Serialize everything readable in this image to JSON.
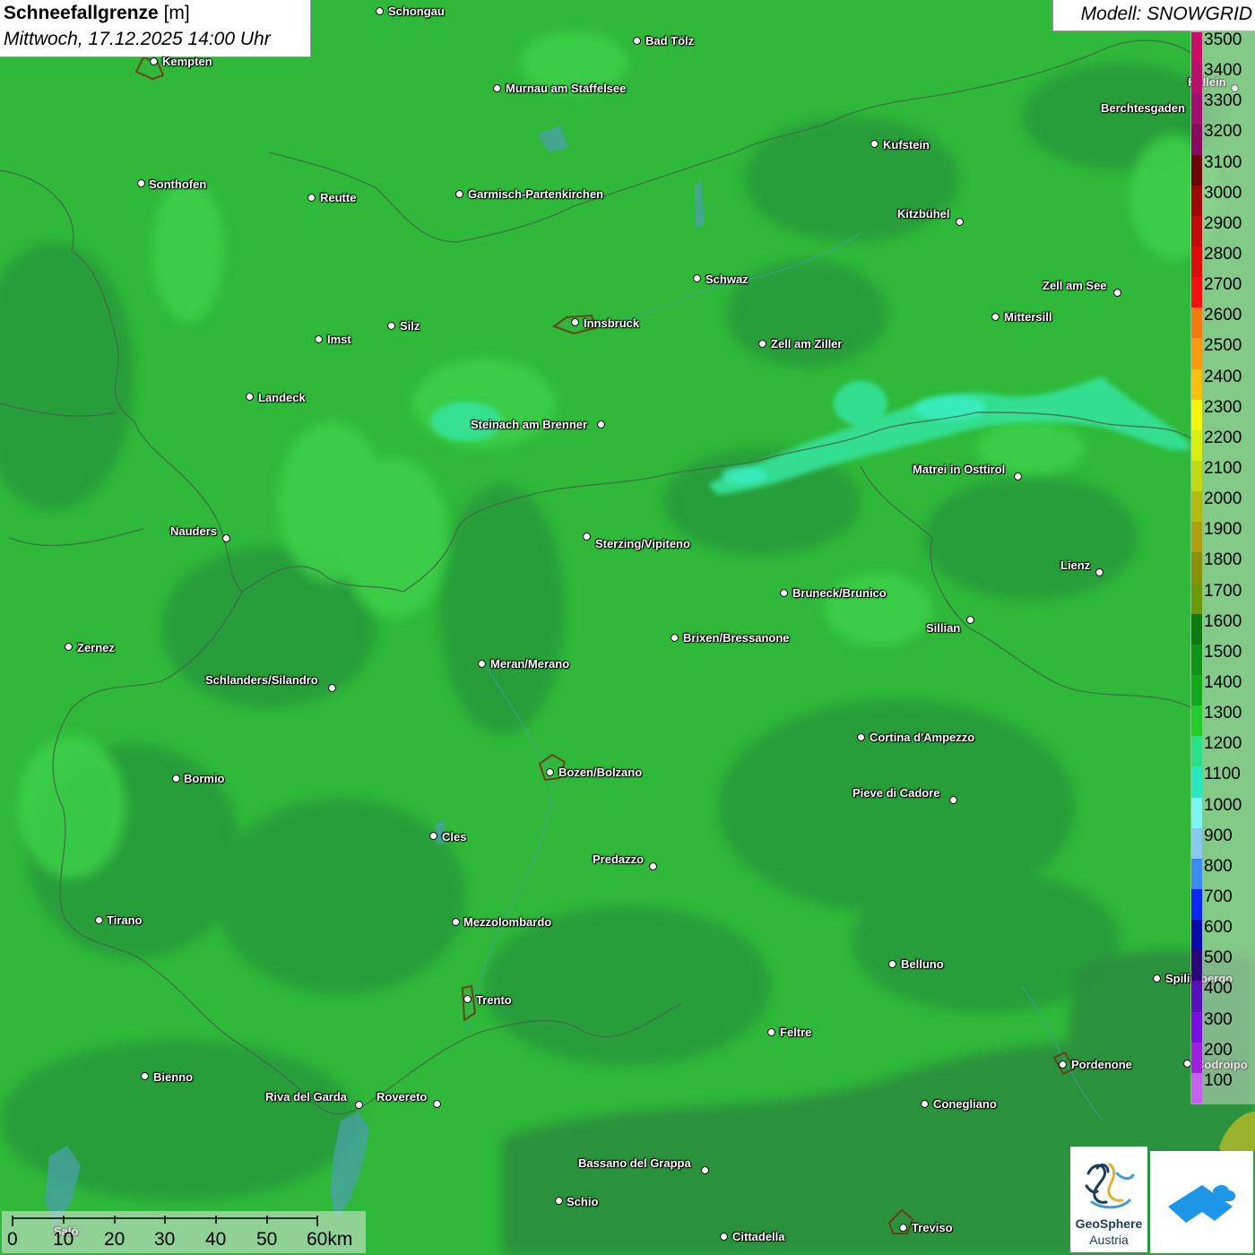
{
  "title": {
    "main": "Schneefallgrenze",
    "unit": "[m]",
    "datetime": "Mittwoch, 17.12.2025 14:00 Uhr"
  },
  "model_label": "Modell: SNOWGRID",
  "legend": {
    "levels": [
      {
        "label": "3500",
        "color": "#c8106a"
      },
      {
        "label": "3400",
        "color": "#b8106a"
      },
      {
        "label": "3300",
        "color": "#a00d6d"
      },
      {
        "label": "3200",
        "color": "#8a0a60"
      },
      {
        "label": "3100",
        "color": "#6e0808"
      },
      {
        "label": "3000",
        "color": "#a00808"
      },
      {
        "label": "2900",
        "color": "#c20a0a"
      },
      {
        "label": "2800",
        "color": "#dc0c0c"
      },
      {
        "label": "2700",
        "color": "#f21010"
      },
      {
        "label": "2600",
        "color": "#f47a10"
      },
      {
        "label": "2500",
        "color": "#f79a10"
      },
      {
        "label": "2400",
        "color": "#f7c010"
      },
      {
        "label": "2300",
        "color": "#f5f510"
      },
      {
        "label": "2200",
        "color": "#d8ee10"
      },
      {
        "label": "2100",
        "color": "#c2d810"
      },
      {
        "label": "2000",
        "color": "#b2bc10"
      },
      {
        "label": "1900",
        "color": "#b0a010"
      },
      {
        "label": "1800",
        "color": "#8a900a"
      },
      {
        "label": "1700",
        "color": "#6c9a0c"
      },
      {
        "label": "1600",
        "color": "#0e7a12"
      },
      {
        "label": "1500",
        "color": "#0e9416"
      },
      {
        "label": "1400",
        "color": "#12aa1c"
      },
      {
        "label": "1300",
        "color": "#22cc2a"
      },
      {
        "label": "1200",
        "color": "#2ce08a"
      },
      {
        "label": "1100",
        "color": "#2ae8c0"
      },
      {
        "label": "1000",
        "color": "#7af5f0"
      },
      {
        "label": "900",
        "color": "#88c8f0"
      },
      {
        "label": "800",
        "color": "#3a8cf0"
      },
      {
        "label": "700",
        "color": "#0c28f0"
      },
      {
        "label": "600",
        "color": "#0a0aa8"
      },
      {
        "label": "500",
        "color": "#2a0878"
      },
      {
        "label": "400",
        "color": "#5a10b8"
      },
      {
        "label": "300",
        "color": "#7a10e0"
      },
      {
        "label": "200",
        "color": "#a020e0"
      },
      {
        "label": "100",
        "color": "#c860ee"
      }
    ]
  },
  "places": [
    {
      "name": "Schongau",
      "dot": [
        424,
        13
      ],
      "label": [
        433,
        5
      ]
    },
    {
      "name": "Kempten",
      "dot": [
        172,
        69
      ],
      "label": [
        181,
        61
      ]
    },
    {
      "name": "Bad Tölz",
      "dot": [
        711,
        46
      ],
      "label": [
        720,
        38
      ]
    },
    {
      "name": "Murnau am Staffelsee",
      "dot": [
        555,
        99
      ],
      "label": [
        564,
        91
      ]
    },
    {
      "name": "Hallein",
      "dot": [
        1378,
        99
      ],
      "label": [
        1325,
        84
      ]
    },
    {
      "name": "Berchtesgaden",
      "dot": null,
      "label": [
        1228,
        113
      ]
    },
    {
      "name": "Kufstein",
      "dot": [
        976,
        161
      ],
      "label": [
        985,
        154
      ]
    },
    {
      "name": "Sonthofen",
      "dot": [
        158,
        205
      ],
      "label": [
        166,
        198
      ]
    },
    {
      "name": "Reutte",
      "dot": [
        348,
        221
      ],
      "label": [
        357,
        213
      ]
    },
    {
      "name": "Garmisch-Partenkirchen",
      "dot": [
        513,
        217
      ],
      "label": [
        522,
        209
      ]
    },
    {
      "name": "Kitzbühel",
      "dot": [
        1071,
        248
      ],
      "label": [
        1001,
        231
      ]
    },
    {
      "name": "Schwaz",
      "dot": [
        778,
        311
      ],
      "label": [
        787,
        304
      ]
    },
    {
      "name": "Zell am See",
      "dot": [
        1247,
        327
      ],
      "label": [
        1163,
        311
      ]
    },
    {
      "name": "Mittersill",
      "dot": [
        1111,
        354
      ],
      "label": [
        1120,
        346
      ]
    },
    {
      "name": "Innsbruck",
      "dot": [
        642,
        360
      ],
      "label": [
        651,
        353
      ]
    },
    {
      "name": "Silz",
      "dot": [
        437,
        364
      ],
      "label": [
        446,
        356
      ]
    },
    {
      "name": "Imst",
      "dot": [
        356,
        379
      ],
      "label": [
        365,
        371
      ]
    },
    {
      "name": "Zell am Ziller",
      "dot": [
        851,
        384
      ],
      "label": [
        860,
        376
      ]
    },
    {
      "name": "Landeck",
      "dot": [
        279,
        443
      ],
      "label": [
        288,
        436
      ]
    },
    {
      "name": "Steinach am Brenner",
      "dot": [
        671,
        474
      ],
      "label": [
        525,
        466
      ]
    },
    {
      "name": "Matrei in Osttirol",
      "dot": [
        1136,
        532
      ],
      "label": [
        1018,
        516
      ]
    },
    {
      "name": "Nauders",
      "dot": [
        253,
        601
      ],
      "label": [
        190,
        585
      ]
    },
    {
      "name": "Sterzing/Vipiteno",
      "dot": [
        655,
        599
      ],
      "label": [
        664,
        599
      ]
    },
    {
      "name": "Lienz",
      "dot": [
        1227,
        639
      ],
      "label": [
        1183,
        623
      ]
    },
    {
      "name": "Bruneck/Brunico",
      "dot": [
        875,
        662
      ],
      "label": [
        884,
        654
      ]
    },
    {
      "name": "Sillian",
      "dot": [
        1083,
        692
      ],
      "label": [
        1033,
        693
      ]
    },
    {
      "name": "Brixen/Bressanone",
      "dot": [
        753,
        712
      ],
      "label": [
        762,
        704
      ]
    },
    {
      "name": "Zernez",
      "dot": [
        77,
        722
      ],
      "label": [
        86,
        715
      ]
    },
    {
      "name": "Meran/Merano",
      "dot": [
        538,
        741
      ],
      "label": [
        547,
        733
      ]
    },
    {
      "name": "Schlanders/Silandro",
      "dot": [
        371,
        768
      ],
      "label": [
        229,
        751
      ]
    },
    {
      "name": "Cortina d'Ampezzo",
      "dot": [
        961,
        823
      ],
      "label": [
        970,
        815
      ]
    },
    {
      "name": "Bozen/Bolzano",
      "dot": [
        614,
        862
      ],
      "label": [
        623,
        854
      ]
    },
    {
      "name": "Bormio",
      "dot": [
        197,
        869
      ],
      "label": [
        205,
        861
      ]
    },
    {
      "name": "Pieve di Cadore",
      "dot": [
        1064,
        893
      ],
      "label": [
        951,
        877
      ]
    },
    {
      "name": "Cles",
      "dot": [
        484,
        933
      ],
      "label": [
        493,
        926
      ]
    },
    {
      "name": "Predazzo",
      "dot": [
        729,
        967
      ],
      "label": [
        661,
        951
      ]
    },
    {
      "name": "Tirano",
      "dot": [
        111,
        1027
      ],
      "label": [
        119,
        1019
      ]
    },
    {
      "name": "Mezzolombardo",
      "dot": [
        509,
        1029
      ],
      "label": [
        517,
        1021
      ]
    },
    {
      "name": "Belluno",
      "dot": [
        996,
        1076
      ],
      "label": [
        1005,
        1068
      ]
    },
    {
      "name": "Spilimbergo",
      "dot": [
        1291,
        1092
      ],
      "label": [
        1300,
        1084
      ]
    },
    {
      "name": "Trento",
      "dot": [
        522,
        1115
      ],
      "label": [
        531,
        1108
      ]
    },
    {
      "name": "Feltre",
      "dot": [
        861,
        1152
      ],
      "label": [
        870,
        1144
      ]
    },
    {
      "name": "Pordenone",
      "dot": [
        1186,
        1188
      ],
      "label": [
        1195,
        1180
      ]
    },
    {
      "name": "Codroipo",
      "dot": [
        1325,
        1187
      ],
      "label": [
        1334,
        1180
      ]
    },
    {
      "name": "Bienno",
      "dot": [
        162,
        1201
      ],
      "label": [
        171,
        1194
      ]
    },
    {
      "name": "Riva del Garda",
      "dot": [
        401,
        1233
      ],
      "label": [
        296,
        1216
      ]
    },
    {
      "name": "Rovereto",
      "dot": [
        488,
        1232
      ],
      "label": [
        420,
        1216
      ]
    },
    {
      "name": "Conegliano",
      "dot": [
        1032,
        1232
      ],
      "label": [
        1041,
        1224
      ]
    },
    {
      "name": "Bassano del Grappa",
      "dot": [
        787,
        1306
      ],
      "label": [
        645,
        1290
      ]
    },
    {
      "name": "Schio",
      "dot": [
        624,
        1340
      ],
      "label": [
        632,
        1333
      ]
    },
    {
      "name": "Treviso",
      "dot": [
        1008,
        1370
      ],
      "label": [
        1017,
        1362
      ]
    },
    {
      "name": "Cittadella",
      "dot": [
        808,
        1380
      ],
      "label": [
        817,
        1372
      ]
    },
    {
      "name": "Salò",
      "dot": null,
      "label": [
        60,
        1366
      ]
    }
  ],
  "scale_bar": {
    "labels": [
      "0",
      "10",
      "20",
      "30",
      "40",
      "50",
      "60km"
    ]
  },
  "logos": {
    "geosphere_line1": "GeoSphere",
    "geosphere_line2": "Austria"
  }
}
